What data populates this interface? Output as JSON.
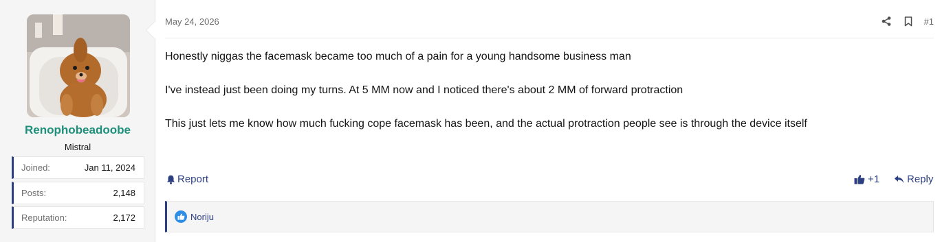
{
  "user": {
    "username": "Renophobeadoobe",
    "title": "Mistral",
    "avatar_icon": "avatar-photo-dog",
    "stats": [
      {
        "label": "Joined:",
        "value": "Jan 11, 2024"
      },
      {
        "label": "Posts:",
        "value": "2,148"
      },
      {
        "label": "Reputation:",
        "value": "2,172"
      }
    ]
  },
  "post": {
    "date": "May 24, 2026",
    "number": "#1",
    "share_icon": "share-icon",
    "bookmark_icon": "bookmark-icon",
    "paragraphs": [
      "Honestly niggas the facemask became too much of a pain for a young handsome business man",
      "I've instead just been doing my turns. At 5 MM now and I noticed there's about 2 MM of forward protraction",
      "This just lets me know how much fucking cope facemask has been, and the actual protraction people see is through the device itself"
    ]
  },
  "actions": {
    "report_label": "Report",
    "react_label": "+1",
    "reply_label": "Reply"
  },
  "reactions": {
    "users": "Noriju"
  },
  "colors": {
    "accent": "#2c3f82",
    "username": "#1e8f7a",
    "like_badge": "#2f8de4"
  }
}
